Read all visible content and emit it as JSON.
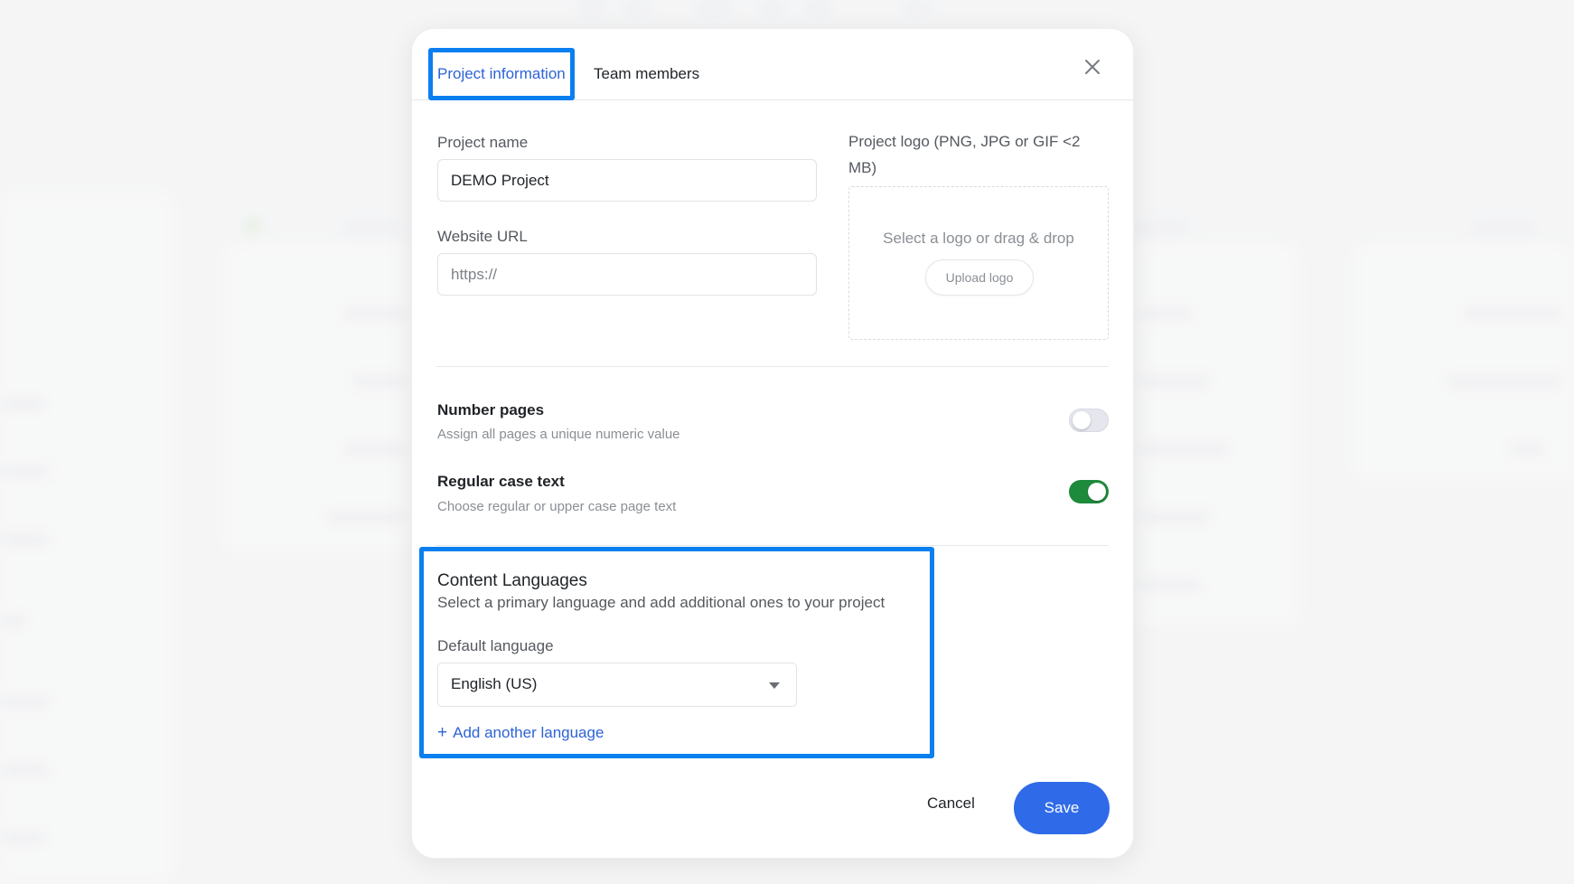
{
  "tabs": [
    {
      "label": "Project information"
    },
    {
      "label": "Team members"
    }
  ],
  "project_name": {
    "label": "Project name",
    "value": "DEMO Project"
  },
  "website_url": {
    "label": "Website URL",
    "placeholder": "https://"
  },
  "project_logo": {
    "label": "Project logo (PNG, JPG or GIF <2 MB)",
    "hint": "Select a logo or drag & drop",
    "button": "Upload logo"
  },
  "settings": [
    {
      "title": "Number pages",
      "description": "Assign all pages a unique numeric value",
      "enabled": false
    },
    {
      "title": "Regular case text",
      "description": "Choose regular or upper case page text",
      "enabled": true
    }
  ],
  "content_languages": {
    "title": "Content Languages",
    "description": "Select a primary language and add additional ones to your project",
    "default_label": "Default language",
    "default_value": "English (US)",
    "add_label": "Add another language"
  },
  "footer": {
    "cancel": "Cancel",
    "save": "Save"
  },
  "colors": {
    "accent": "#2f6be8",
    "toggle_on": "#1e8a3c",
    "highlight": "#0a7ff0"
  }
}
